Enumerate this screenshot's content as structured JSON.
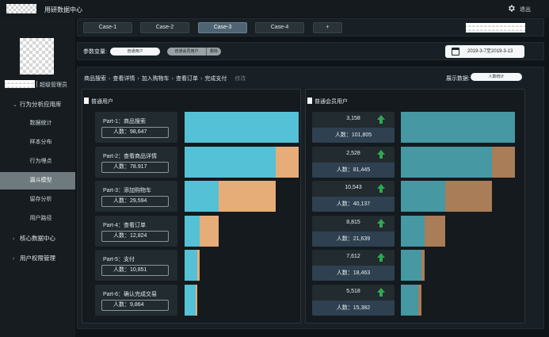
{
  "header": {
    "app_title": "用研数据中心",
    "logout_label": "退出"
  },
  "sidebar": {
    "role": "超级管理员",
    "groups": [
      {
        "label": "行为分析应用库",
        "expanded": true
      },
      {
        "label": "核心数据中心",
        "expanded": false
      },
      {
        "label": "用户权限管理",
        "expanded": false
      }
    ],
    "items": [
      {
        "label": "数据统计"
      },
      {
        "label": "样本分布"
      },
      {
        "label": "行为埋点"
      },
      {
        "label": "漏斗模型",
        "active": true
      },
      {
        "label": "留存分析"
      },
      {
        "label": "用户路径"
      }
    ]
  },
  "tabs": {
    "items": [
      "Case-1",
      "Case-2",
      "Case-3",
      "Case-4",
      "+"
    ],
    "active": "Case-3"
  },
  "params": {
    "label": "参数变量:",
    "pill_1": "普通用户",
    "pill_2": "普通会员用户",
    "pill_2_remove": "删除",
    "date_range": "2019-3-7至2019-3-13"
  },
  "main": {
    "breadcrumb": [
      "商品搜索",
      "查看详情",
      "加入购物车",
      "查看订单",
      "完成支付"
    ],
    "edit_label": "修改",
    "display_label": "展示数据:",
    "display_value": "人数统计"
  },
  "colors": {
    "left_bar": "#55c1d6",
    "left_drop": "#e6ad78",
    "right_bar": "#4698a3",
    "right_drop": "#a87d58",
    "up_arrow": "#2fa84f"
  },
  "left_panel": {
    "title": "普通用户",
    "steps": [
      {
        "name": "Part-1：商品搜索",
        "count": "人数：98,647",
        "bar_pct": 1.0,
        "drop_pct": 0.0
      },
      {
        "name": "Part-2：查看商品详情",
        "count": "人数：78.917",
        "bar_pct": 0.8,
        "drop_pct": 0.2
      },
      {
        "name": "Part-3：添加购物车",
        "count": "人数：29,594",
        "bar_pct": 0.3,
        "drop_pct": 0.5
      },
      {
        "name": "Part-4：查看订单",
        "count": "人数：12,824",
        "bar_pct": 0.13,
        "drop_pct": 0.17
      },
      {
        "name": "Part-5：支付",
        "count": "人数：10,851",
        "bar_pct": 0.11,
        "drop_pct": 0.02
      },
      {
        "name": "Part-6：确认完成交易",
        "count": "人数：9,864",
        "bar_pct": 0.1,
        "drop_pct": 0.01
      }
    ]
  },
  "right_panel": {
    "title": "普通会员用户",
    "steps": [
      {
        "delta": "3,158",
        "count": "人数：101,805",
        "bar_pct": 1.0,
        "drop_pct": 0.0
      },
      {
        "delta": "2,528",
        "count": "人数：81,445",
        "bar_pct": 0.8,
        "drop_pct": 0.2
      },
      {
        "delta": "10,543",
        "count": "人数：40,137",
        "bar_pct": 0.39,
        "drop_pct": 0.41
      },
      {
        "delta": "8,815",
        "count": "人数：21,639",
        "bar_pct": 0.21,
        "drop_pct": 0.18
      },
      {
        "delta": "7,612",
        "count": "人数：18,463",
        "bar_pct": 0.18,
        "drop_pct": 0.03
      },
      {
        "delta": "5,518",
        "count": "人数：15,382",
        "bar_pct": 0.15,
        "drop_pct": 0.03
      }
    ]
  }
}
